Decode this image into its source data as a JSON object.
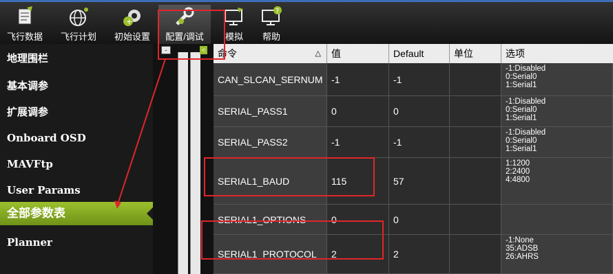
{
  "toolbar": {
    "items": [
      {
        "label": "飞行数据",
        "icon": "flight-data-icon"
      },
      {
        "label": "飞行计划",
        "icon": "flight-plan-icon"
      },
      {
        "label": "初始设置",
        "icon": "initial-setup-icon"
      },
      {
        "label": "配置/调试",
        "icon": "config-tuning-icon"
      },
      {
        "label": "模拟",
        "icon": "simulation-icon"
      },
      {
        "label": "帮助",
        "icon": "help-icon"
      }
    ]
  },
  "sidebar": {
    "items": [
      {
        "label": "地理围栏"
      },
      {
        "label": "基本调参"
      },
      {
        "label": "扩展调参"
      },
      {
        "label": "Onboard OSD"
      },
      {
        "label": "MAVFtp"
      },
      {
        "label": "User Params"
      },
      {
        "label": "全部参数表",
        "active": true
      },
      {
        "label": "Planner"
      }
    ]
  },
  "tree": {
    "collapse_label": "-",
    "expand_label": "<"
  },
  "table": {
    "headers": {
      "command": "命令",
      "value": "值",
      "default": "Default",
      "units": "单位",
      "options": "选项"
    },
    "rows": [
      {
        "command": "CAN_SLCAN_SERNUM",
        "value": "-1",
        "default": "-1",
        "units": "",
        "options": [
          "-1:Disabled",
          "0:Serial0",
          "1:Serial1"
        ]
      },
      {
        "command": "SERIAL_PASS1",
        "value": "0",
        "default": "0",
        "units": "",
        "options": [
          "-1:Disabled",
          "0:Serial0",
          "1:Serial1"
        ]
      },
      {
        "command": "SERIAL_PASS2",
        "value": "-1",
        "default": "-1",
        "units": "",
        "options": [
          "-1:Disabled",
          "0:Serial0",
          "1:Serial1"
        ]
      },
      {
        "command": "SERIAL1_BAUD",
        "value": "115",
        "default": "57",
        "units": "",
        "options": [
          "1:1200",
          "2:2400",
          "4:4800"
        ]
      },
      {
        "command": "SERIAL1_OPTIONS",
        "value": "0",
        "default": "0",
        "units": "",
        "options": []
      },
      {
        "command": "SERIAL1_PROTOCOL",
        "value": "2",
        "default": "2",
        "units": "",
        "options": [
          "-1:None",
          "35:ADSB",
          "26:AHRS"
        ]
      }
    ]
  },
  "colors": {
    "accent_green": "#9bc02d",
    "annotation_red": "#e0262a",
    "toolbar_top": "#3c6fb8"
  }
}
